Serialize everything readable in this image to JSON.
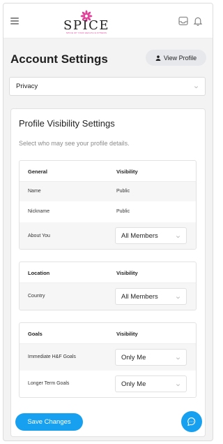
{
  "header": {
    "logo_word": "SPICE",
    "logo_tagline": "SPICE UP YOUR HEALTH & FITNESS",
    "icons": [
      "menu-icon",
      "inbox-icon",
      "bell-icon"
    ]
  },
  "page": {
    "title": "Account Settings",
    "view_profile_label": "View Profile",
    "section_select_value": "Privacy"
  },
  "card": {
    "title": "Profile Visibility Settings",
    "subtitle": "Select who may see your profile details."
  },
  "tables": {
    "general": {
      "header": "General",
      "visibility_header": "Visibility",
      "rows": [
        {
          "label": "Name",
          "value": "Public"
        },
        {
          "label": "Nickname",
          "value": "Public"
        },
        {
          "label": "About You",
          "value": "All Members"
        }
      ]
    },
    "location": {
      "header": "Location",
      "visibility_header": "Visibility",
      "rows": [
        {
          "label": "Country",
          "value": "All Members"
        }
      ]
    },
    "goals": {
      "header": "Goals",
      "visibility_header": "Visibility",
      "rows": [
        {
          "label": "Immediate H&F Goals",
          "value": "Only Me"
        },
        {
          "label": "Longer Term Goals",
          "value": "Only Me"
        }
      ]
    }
  },
  "actions": {
    "save_label": "Save Changes"
  },
  "colors": {
    "accent": "#18a0f0",
    "logo_pink": "#e0409a"
  }
}
